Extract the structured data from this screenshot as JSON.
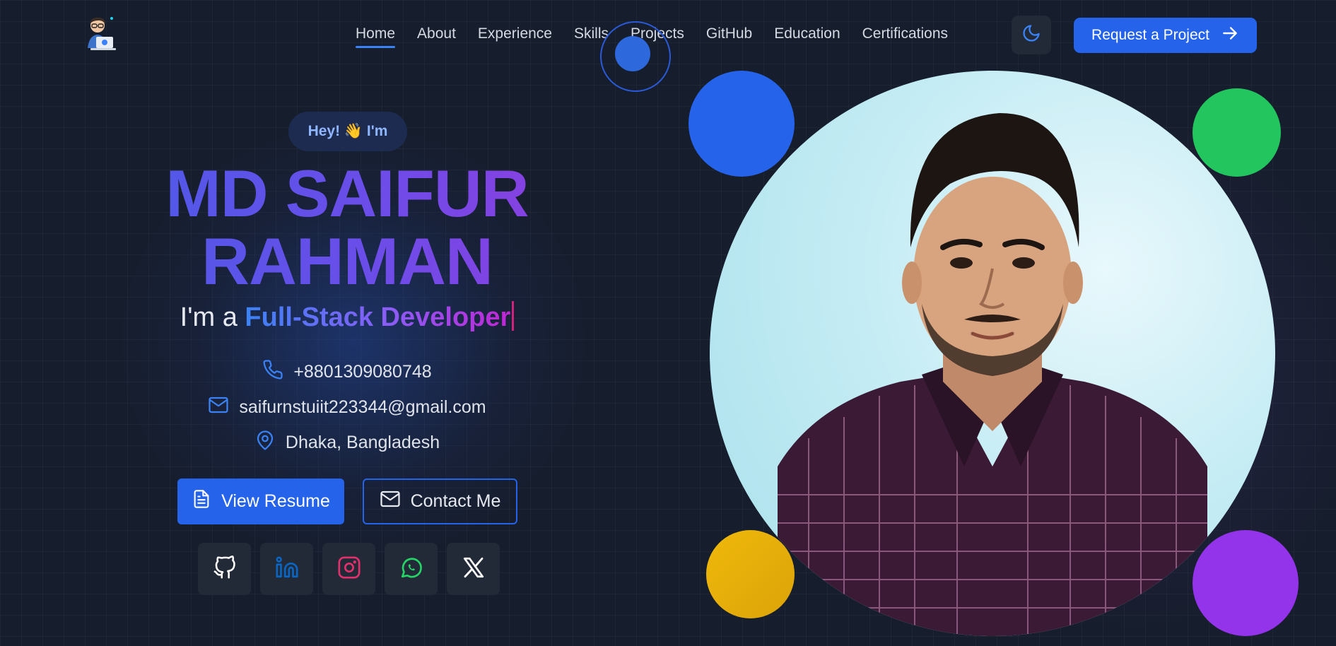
{
  "nav": {
    "items": [
      {
        "label": "Home",
        "active": true
      },
      {
        "label": "About"
      },
      {
        "label": "Experience"
      },
      {
        "label": "Skills"
      },
      {
        "label": "Projects"
      },
      {
        "label": "GitHub"
      },
      {
        "label": "Education"
      },
      {
        "label": "Certifications"
      }
    ],
    "theme_icon": "moon-icon",
    "cta_label": "Request a Project",
    "cta_icon": "arrow-right-icon"
  },
  "hero": {
    "greeting": "Hey! 👋 I'm",
    "name_line1": "MD SAIFUR",
    "name_line2": "RAHMAN",
    "role_prefix": "I'm a",
    "role": "Full-Stack Developer",
    "phone": "+8801309080748",
    "email": "saifurnstuiit223344@gmail.com",
    "location": "Dhaka, Bangladesh",
    "resume_label": "View Resume",
    "contact_label": "Contact Me"
  },
  "socials": [
    {
      "icon": "github-icon"
    },
    {
      "icon": "linkedin-icon"
    },
    {
      "icon": "instagram-icon"
    },
    {
      "icon": "whatsapp-icon"
    },
    {
      "icon": "x-icon"
    }
  ],
  "colors": {
    "background": "#161d2c",
    "accent": "#2563eb",
    "blob_blue": "#2563eb",
    "blob_green": "#22c55e",
    "blob_yellow": "#eab308",
    "blob_purple": "#9333ea"
  }
}
